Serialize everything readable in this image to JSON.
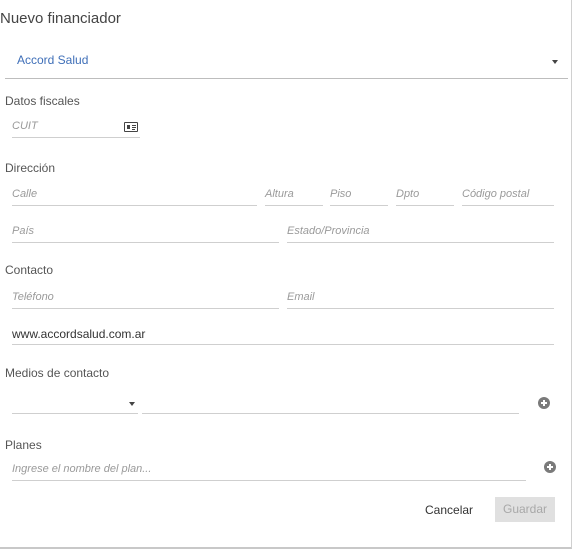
{
  "dialog": {
    "title": "Nuevo financiador"
  },
  "financiador": {
    "selected": "Accord Salud"
  },
  "fiscal": {
    "section": "Datos fiscales",
    "cuit_placeholder": "CUIT"
  },
  "direccion": {
    "section": "Dirección",
    "calle": "Calle",
    "altura": "Altura",
    "piso": "Piso",
    "dpto": "Dpto",
    "codigo_postal": "Código postal",
    "pais": "País",
    "estado": "Estado/Provincia"
  },
  "contacto": {
    "section": "Contacto",
    "telefono": "Teléfono",
    "email": "Email",
    "web": "www.accordsalud.com.ar"
  },
  "medios": {
    "section": "Medios de contacto"
  },
  "planes": {
    "section": "Planes",
    "placeholder": "Ingrese el nombre del plan..."
  },
  "actions": {
    "cancel": "Cancelar",
    "save": "Guardar"
  },
  "icons": {
    "id_card": "id-card-icon",
    "add": "add-circle-icon",
    "dropdown": "caret-down-icon"
  },
  "colors": {
    "selected_text": "#3f6fb8",
    "save_disabled_bg": "#e0e0e0"
  }
}
